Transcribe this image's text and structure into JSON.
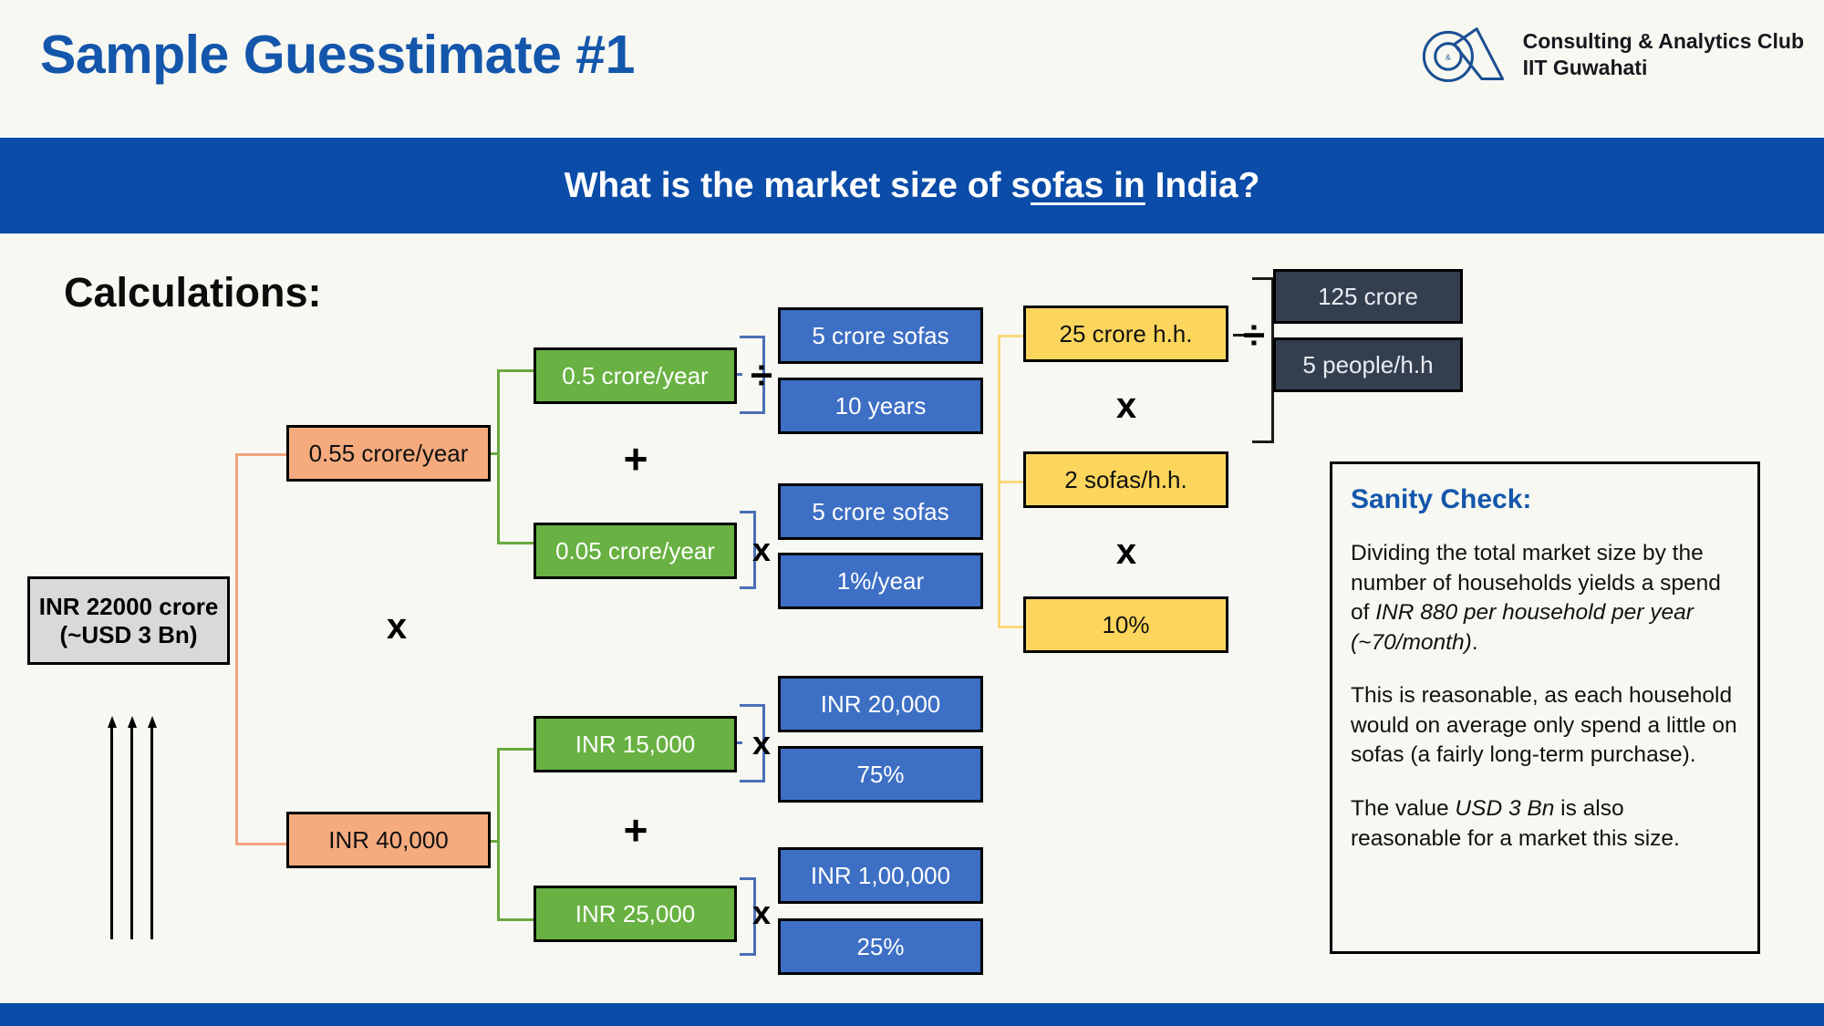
{
  "header": {
    "title": "Sample Guesstimate #1",
    "brand": {
      "logo_icon": "ca-monogram-logo",
      "line1": "Consulting & Analytics Club",
      "line2": "IIT Guwahati"
    }
  },
  "question": {
    "prefix": "What is the market size of s",
    "underlined": "ofas in",
    "suffix": " India?"
  },
  "section": {
    "heading": "Calculations:"
  },
  "nodes": {
    "total": {
      "line1": "INR 22000 crore",
      "line2": "(~USD 3 Bn)"
    },
    "peach_top": "0.55 crore/year",
    "peach_bottom": "INR 40,000",
    "green_1": "0.5 crore/year",
    "green_2": "0.05 crore/year",
    "green_3": "INR 15,000",
    "green_4": "INR 25,000",
    "blue_1": "5 crore sofas",
    "blue_2": "10 years",
    "blue_3": "5 crore sofas",
    "blue_4": "1%/year",
    "blue_5": "INR 20,000",
    "blue_6": "75%",
    "blue_7": "INR 1,00,000",
    "blue_8": "25%",
    "yellow_1": "25 crore h.h.",
    "yellow_2": "2 sofas/h.h.",
    "yellow_3": "10%",
    "dark_1": "125 crore",
    "dark_2": "5 people/h.h"
  },
  "operators": {
    "multiply": "x",
    "plus": "+",
    "divide": "÷"
  },
  "sanity": {
    "title": "Sanity Check:",
    "p1_a": "Dividing the total market size by the number of households yields a spend of ",
    "p1_em": "INR 880 per household per year (~70/month)",
    "p1_b": ".",
    "p2": "This is reasonable, as each household would on average only spend a little on sofas (a fairly long-term purchase).",
    "p3_a": "The value ",
    "p3_em": "USD 3 Bn",
    "p3_b": " is also reasonable for a market this size."
  },
  "colors": {
    "brand_blue": "#0a4ca8",
    "title_blue": "#1456ab",
    "peach": "#f6ab7e",
    "green": "#68b142",
    "blue": "#3d6fc4",
    "yellow": "#fcd65c",
    "dark": "#333e4f",
    "gray": "#d9d9d9",
    "background": "#f7f8f2"
  }
}
